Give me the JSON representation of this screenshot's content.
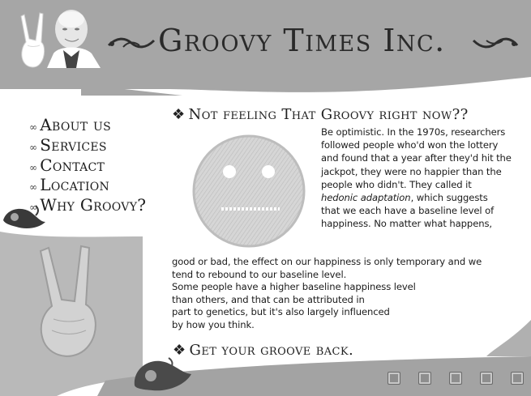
{
  "site": {
    "title": "Groovy Times Inc."
  },
  "nav": {
    "items": [
      {
        "label": "About us"
      },
      {
        "label": "Services"
      },
      {
        "label": "Contact"
      },
      {
        "label": "Location"
      },
      {
        "label": "Why Groovy?"
      }
    ]
  },
  "main": {
    "heading": "Not feeling That Groovy right now??",
    "paragraph_lines_right": [
      "Be optimistic.  In the 1970s, researchers",
      "followed people who'd won the lottery",
      "and found that a year after they'd hit the",
      "jackpot, they were no happier than the",
      "people who didn't. They called it",
      "hedonic adaptation, which suggests",
      "that we each have a baseline level of",
      "happiness. No matter what happens,"
    ],
    "paragraph_lines_full": [
      "good or bad, the effect on our happiness is only temporary and we",
      "tend to rebound to our baseline level.",
      "Some people have a higher baseline happiness level",
      "than others, and that can be attributed in",
      "part to genetics, but it's also largely influenced",
      "by how you think."
    ],
    "cta": "Get your groove back."
  },
  "footer": {
    "icons": [
      "rss-icon",
      "facebook-icon",
      "myspace-icon",
      "delicious-icon",
      "twitter-icon"
    ]
  },
  "colors": {
    "background": "#ffffff",
    "gray_band": "#a6a6a6",
    "light_gray_panel": "#b7b7b7",
    "text": "#1e1e1e"
  }
}
